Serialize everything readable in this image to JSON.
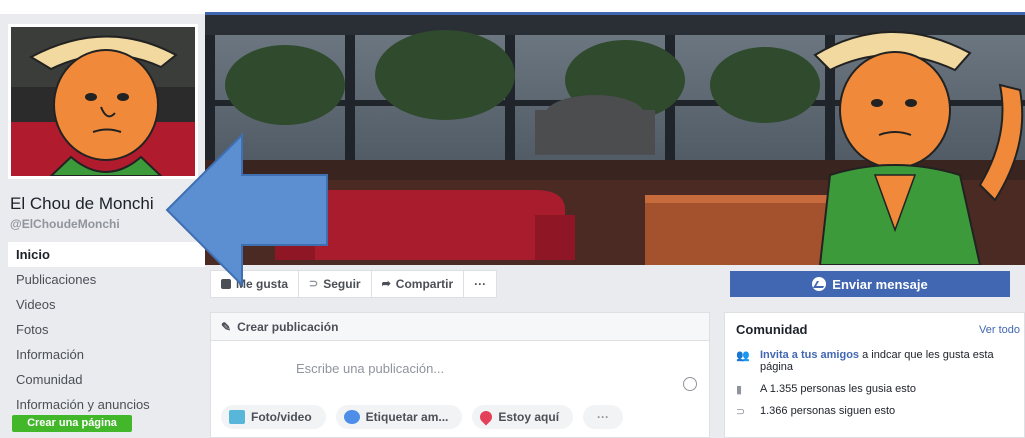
{
  "page": {
    "name": "El Chou de Monchi",
    "handle": "@ElChoudeMonchi"
  },
  "nav": [
    {
      "label": "Inicio",
      "active": true
    },
    {
      "label": "Publicaciones"
    },
    {
      "label": "Videos"
    },
    {
      "label": "Fotos"
    },
    {
      "label": "Información"
    },
    {
      "label": "Comunidad"
    },
    {
      "label": "Información y anuncios"
    }
  ],
  "create_page_label": "Crear una página",
  "actions": {
    "like": "Me gusta",
    "follow": "Seguir",
    "share": "Compartir",
    "more": "···"
  },
  "send_message": "Enviar mensaje",
  "composer": {
    "title": "Crear publicación",
    "placeholder": "Escribe una publicación...",
    "options": [
      "Foto/video",
      "Etiquetar am...",
      "Estoy aquí",
      "···"
    ]
  },
  "community": {
    "title": "Comunidad",
    "see_all": "Ver todo",
    "invite_link": "Invita a tus amigos",
    "invite_rest": "a indcar que les gusta esta página",
    "likes_text": "A 1.355 personas les gusia esto",
    "followers_text": "1.366 personas siguen esto"
  },
  "colors": {
    "brand": "#4267b2",
    "green": "#42b72a",
    "arrow": "#5b8fd2"
  }
}
